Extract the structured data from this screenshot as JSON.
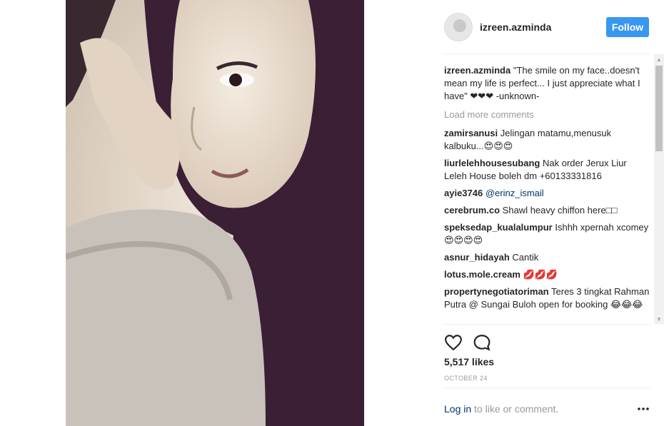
{
  "photo": {
    "alt_icon": "photo-post"
  },
  "header": {
    "username": "izreen.azminda",
    "follow_label": "Follow",
    "avatar_icon": "profile-avatar"
  },
  "caption": {
    "user": "izreen.azminda",
    "text": "\"The smile on my face..doesn't mean my life is perfect... I just appreciate what I have\" ❤❤❤ -unknown-"
  },
  "load_more_label": "Load more comments",
  "comments": [
    {
      "user": "zamirsanusi",
      "text": "Jelingan matamu,menusuk kalbuku...😍😍😍"
    },
    {
      "user": "liurlelehhousesubang",
      "text": "Nak order Jerux Liur Leleh House boleh dm +60133331816"
    },
    {
      "user": "ayie3746",
      "mention": "@erinz_ismail"
    },
    {
      "user": "cerebrum.co",
      "text": "Shawl heavy chiffon here□□"
    },
    {
      "user": "speksedap_kualalumpur",
      "text": "Ishhh xpernah xcomey😍😍😍😍"
    },
    {
      "user": "asnur_hidayah",
      "text": "Cantik"
    },
    {
      "user": "lotus.mole.cream",
      "text": "💋💋💋"
    },
    {
      "user": "propertynegotiatoriman",
      "text": "Teres 3 tingkat Rahman Putra @ Sungai Buloh open for booking 😂😂😂"
    }
  ],
  "actions": {
    "like_icon": "heart-icon",
    "comment_icon": "comment-icon"
  },
  "likes_text": "5,517 likes",
  "date_text": "OCTOBER 24",
  "footer": {
    "login_link": "Log in",
    "login_rest": " to like or comment.",
    "more_icon": "more-options-icon"
  },
  "colors": {
    "follow_button": "#3897f0",
    "link": "#003569",
    "muted": "#999999",
    "divider": "#efefef"
  }
}
